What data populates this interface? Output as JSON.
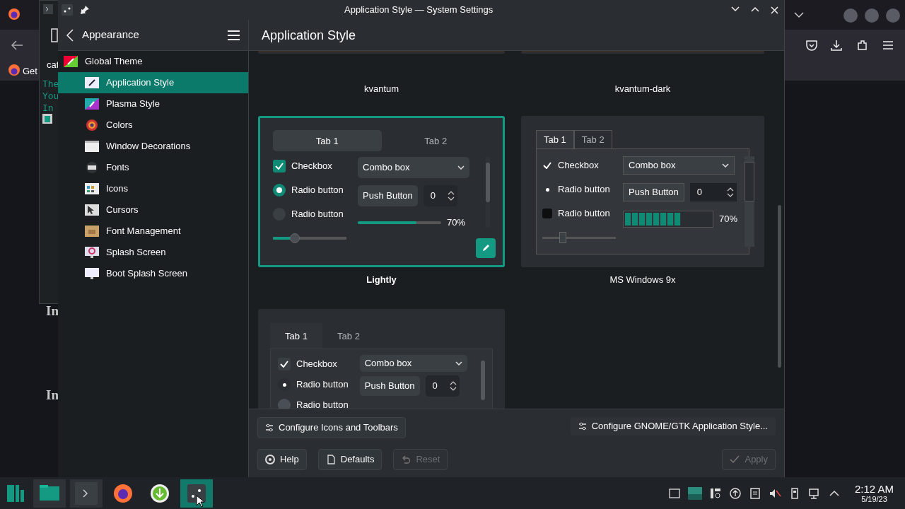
{
  "browser": {
    "bookmark": "Get"
  },
  "terminal": {
    "tab_title": "cat",
    "lines": [
      "The",
      "You",
      "In"
    ]
  },
  "page_headings": [
    "In",
    "In"
  ],
  "window": {
    "title": "Application Style — System Settings"
  },
  "sidebar": {
    "title": "Appearance",
    "items": [
      {
        "label": "Global Theme",
        "selected": false,
        "children": [
          {
            "label": "Application Style",
            "selected": true
          },
          {
            "label": "Plasma Style",
            "selected": false
          },
          {
            "label": "Colors",
            "selected": false
          },
          {
            "label": "Window Decorations",
            "selected": false
          },
          {
            "label": "Fonts",
            "selected": false
          },
          {
            "label": "Icons",
            "selected": false
          },
          {
            "label": "Cursors",
            "selected": false
          },
          {
            "label": "Font Management",
            "selected": false
          },
          {
            "label": "Splash Screen",
            "selected": false
          },
          {
            "label": "Boot Splash Screen",
            "selected": false
          }
        ]
      }
    ]
  },
  "page": {
    "title": "Application Style"
  },
  "styles": [
    {
      "name": "kvantum",
      "selected": false,
      "kind": "cut"
    },
    {
      "name": "kvantum-dark",
      "selected": false,
      "kind": "cut"
    },
    {
      "name": "Lightly",
      "selected": true,
      "kind": "rounded",
      "preview": {
        "tabs": [
          {
            "label": "Tab 1",
            "selected": true
          },
          {
            "label": "Tab 2",
            "selected": false
          }
        ],
        "checkbox": {
          "label": "Checkbox",
          "checked": true
        },
        "radios": [
          {
            "label": "Radio button",
            "selected": true
          },
          {
            "label": "Radio button",
            "selected": false
          }
        ],
        "combo": "Combo box",
        "push": "Push Button",
        "spin": "0",
        "slider": {
          "level": 0.3
        },
        "progress": {
          "level": 0.7,
          "reading": "70%"
        }
      }
    },
    {
      "name": "MS Windows 9x",
      "selected": false,
      "kind": "classic",
      "preview": {
        "tabs": [
          {
            "label": "Tab 1",
            "selected": true
          },
          {
            "label": "Tab 2",
            "selected": false
          }
        ],
        "checkbox": {
          "label": "Checkbox",
          "checked": true
        },
        "radios": [
          {
            "label": "Radio button",
            "selected": true
          },
          {
            "label": "Radio button",
            "selected": false
          }
        ],
        "combo": "Combo box",
        "push": "Push Button",
        "spin": "0",
        "slider": {
          "level": 0.3
        },
        "progress": {
          "level": 0.65,
          "reading": "70%"
        }
      }
    },
    {
      "selected": false,
      "kind": "tabbed",
      "preview": {
        "tabs": [
          {
            "label": "Tab 1",
            "selected": true
          },
          {
            "label": "Tab 2",
            "selected": false
          }
        ],
        "checkbox": {
          "label": "Checkbox",
          "checked": true
        },
        "radios": [
          {
            "label": "Radio button",
            "selected": true
          },
          {
            "label": "Radio button",
            "selected": false
          }
        ],
        "combo": "Combo box",
        "push": "Push Button",
        "spin": "0"
      }
    }
  ],
  "config_buttons": [
    "Configure Icons and Toolbars",
    "Configure GNOME/GTK Application Style..."
  ],
  "footer_buttons": [
    {
      "label": "Help",
      "disabled": false
    },
    {
      "label": "Defaults",
      "disabled": false
    },
    {
      "label": "Reset",
      "disabled": true
    },
    {
      "label": "Apply",
      "disabled": true
    }
  ],
  "taskbar": {
    "tasks": [
      {
        "open": true,
        "selected": false
      },
      {
        "open": true,
        "selected": false
      },
      {
        "open": false,
        "selected": false
      },
      {
        "open": false,
        "selected": false
      },
      {
        "open": true,
        "selected": true
      }
    ],
    "clock": {
      "time": "2:12 AM",
      "date": "5/19/23"
    }
  }
}
